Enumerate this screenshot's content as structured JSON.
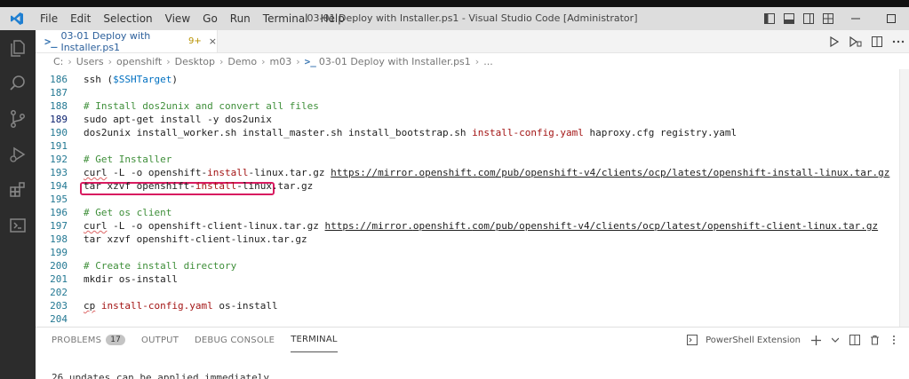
{
  "menu": [
    "File",
    "Edit",
    "Selection",
    "View",
    "Go",
    "Run",
    "Terminal",
    "Help"
  ],
  "window_title": "03-01 Deploy with Installer.ps1 - Visual Studio Code [Administrator]",
  "tab": {
    "icon_text": ">_",
    "name": "03-01 Deploy with Installer.ps1",
    "badge": "9+",
    "close": "×"
  },
  "breadcrumb": {
    "parts": [
      "C:",
      "Users",
      "openshift",
      "Desktop",
      "Demo",
      "m03"
    ],
    "file": "03-01 Deploy with Installer.ps1",
    "tail": "..."
  },
  "editor": {
    "lines": [
      {
        "n": "186",
        "code": "ssh (",
        "var": "$SSHTarget",
        "after": ")"
      },
      {
        "n": "187",
        "code": ""
      },
      {
        "n": "188",
        "comment": "# Install dos2unix and convert all files"
      },
      {
        "n": "189",
        "code": "sudo apt-get install -y dos2unix"
      },
      {
        "n": "190",
        "a": "dos2unix install_worker.sh install_master.sh install_bootstrap.sh ",
        "s": "install-config.yaml",
        "b": " haproxy.cfg registry.yaml"
      },
      {
        "n": "191",
        "code": ""
      },
      {
        "n": "192",
        "comment": "# Get Installer"
      },
      {
        "n": "193",
        "cmd": "curl",
        "a": " -L -o openshift-",
        "s1": "install",
        "b": "-linux.tar.gz ",
        "u1": "https://mirror.",
        "us1": "openshift",
        "u2": ".",
        "us2": "com",
        "u3": "/pub/openshift-v4/clients/ocp/latest/openshift-",
        "us3": "install",
        "u4": "-linux.tar.gz"
      },
      {
        "n": "194",
        "a": "tar xzvf openshift-",
        "s": "install",
        "b": "-linux.tar.gz"
      },
      {
        "n": "195",
        "code": ""
      },
      {
        "n": "196",
        "comment": "# Get os client"
      },
      {
        "n": "197",
        "cmd": "curl",
        "a": " -L -o openshift-client-linux.tar.gz ",
        "u1": "https://mirror.",
        "us1": "openshift",
        "u2": ".",
        "us2": "com",
        "u3": "/pub/openshift-v4/clients/ocp/latest/openshift-client-linux.tar.gz"
      },
      {
        "n": "198",
        "code": "tar xzvf openshift-client-linux.tar.gz"
      },
      {
        "n": "199",
        "code": ""
      },
      {
        "n": "200",
        "comment": "# Create install directory"
      },
      {
        "n": "201",
        "code": "mkdir os-install"
      },
      {
        "n": "202",
        "code": ""
      },
      {
        "n": "203",
        "cmd": "cp",
        "a": " ",
        "s": "install-config.yaml",
        "b": " os-install"
      },
      {
        "n": "204",
        "code": ""
      }
    ]
  },
  "panel": {
    "tabs": [
      "PROBLEMS",
      "OUTPUT",
      "DEBUG CONSOLE",
      "TERMINAL"
    ],
    "problems_count": "17",
    "terminal_profile": "PowerShell Extension",
    "terminal_text": "26 updates can be applied immediately."
  }
}
